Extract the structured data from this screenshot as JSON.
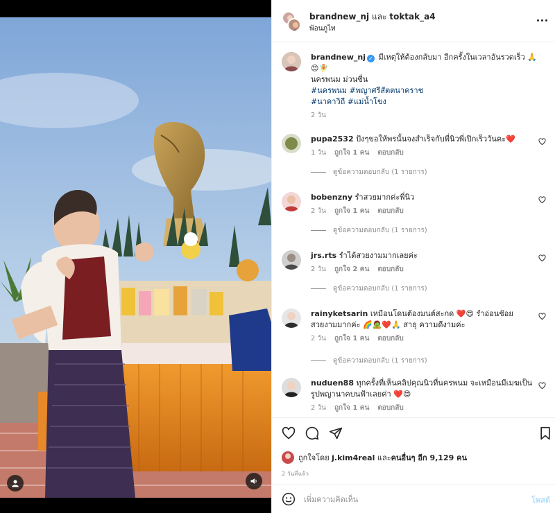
{
  "header": {
    "user1": "brandnew_nj",
    "connector": " และ ",
    "user2": "toktak_a4",
    "location": "พ้อนภูไท"
  },
  "caption": {
    "username": "brandnew_nj",
    "verified": "✓",
    "text_line1": " มีเหตุให้ต้องกลับมา อีกครั้งในเวลาอันรวดเร็ว 🙏",
    "text_line1b": "😍🧚",
    "text_line2": "นครพนม ม่วนซื่น",
    "tags_line1": "#นครพนม #พญาศรีสัตตนาคราช",
    "tags_line2": "#นาคาวิถี #แม่น้ำโขง",
    "time": "2 วัน"
  },
  "comments": [
    {
      "username": "pupa2532",
      "text": " ปังๆขอให้พรนั้นจงสำเร็จกับพี่นิวพี่เปิกเร็ววันคะ❤️",
      "time": "1 วัน",
      "likes": "ถูกใจ 1 คน",
      "reply": "ตอบกลับ",
      "view_replies": "ดูข้อความตอบกลับ (1 รายการ)"
    },
    {
      "username": "bobenzny",
      "text": " รำสวยมากค่ะพี่นิว",
      "time": "2 วัน",
      "likes": "ถูกใจ 1 คน",
      "reply": "ตอบกลับ",
      "view_replies": "ดูข้อความตอบกลับ (1 รายการ)"
    },
    {
      "username": "jrs.rts",
      "text": " รำได้สวยงามมากเลยค่ะ",
      "time": "2 วัน",
      "likes": "ถูกใจ 2 คน",
      "reply": "ตอบกลับ",
      "view_replies": "ดูข้อความตอบกลับ (1 รายการ)"
    },
    {
      "username": "rainyketsarin",
      "text": " เหมือนโดนต้องมนต์สะกด ❤️😍 รำอ่อนช้อย",
      "text2": "สวยงามมากค่ะ 🌈🧟❤️🙏 สาธุ ความดีงามค่ะ",
      "time": "2 วัน",
      "likes": "ถูกใจ 1 คน",
      "reply": "ตอบกลับ",
      "view_replies": "ดูข้อความตอบกลับ (1 รายการ)"
    },
    {
      "username": "nuduen88",
      "text": " ทุกครั้งที่เห็นคลิปคุณนิวที่นครพนม จะเหมือนมีเมฆเป็น",
      "text2": "รูปพญานาคบนฟ้าเลยค่า ❤️😍",
      "time": "2 วัน",
      "likes": "ถูกใจ 1 คน",
      "reply": "ตอบกลับ"
    }
  ],
  "likes_line": {
    "prefix": "ถูกใจโดย ",
    "user": "j.kim4real",
    "middle": " และ",
    "others": "คนอื่นๆ อีก 9,129 คน"
  },
  "posted_time": "2 วันที่แล้ว",
  "add_comment": {
    "placeholder": "เพิ่มความคิดเห็น",
    "post_label": "โพสต์"
  },
  "icons": {
    "more": "more-options-icon",
    "heart": "heart-icon",
    "comment": "comment-icon",
    "share": "share-icon",
    "save": "bookmark-icon",
    "emoji": "emoji-icon",
    "user_tag": "user-tag-icon",
    "sound": "speaker-icon"
  },
  "colors": {
    "link": "#00376b",
    "secondary_text": "#8e8e8e",
    "verified": "#3897f0",
    "post_button": "#b2dffc",
    "heart_red": "#e0245e"
  }
}
